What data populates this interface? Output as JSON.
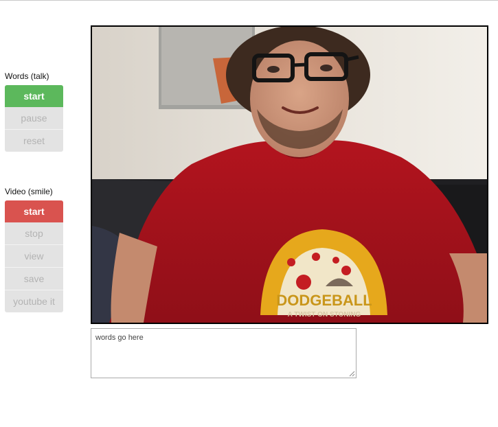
{
  "words_section": {
    "label": "Words (talk)",
    "buttons": [
      {
        "label": "start",
        "state": "active",
        "color": "#5cb85c"
      },
      {
        "label": "pause",
        "state": "disabled"
      },
      {
        "label": "reset",
        "state": "disabled"
      }
    ]
  },
  "video_section": {
    "label": "Video (smile)",
    "buttons": [
      {
        "label": "start",
        "state": "active",
        "color": "#d9534f"
      },
      {
        "label": "stop",
        "state": "disabled"
      },
      {
        "label": "view",
        "state": "disabled"
      },
      {
        "label": "save",
        "state": "disabled"
      },
      {
        "label": "youtube it",
        "state": "disabled"
      }
    ]
  },
  "webcam": {
    "content": "live webcam feed",
    "shirt_print": "DODGEBALL",
    "shirt_tagline": "A TWIST ON STONING"
  },
  "transcript": {
    "value": "",
    "placeholder": "words go here"
  }
}
